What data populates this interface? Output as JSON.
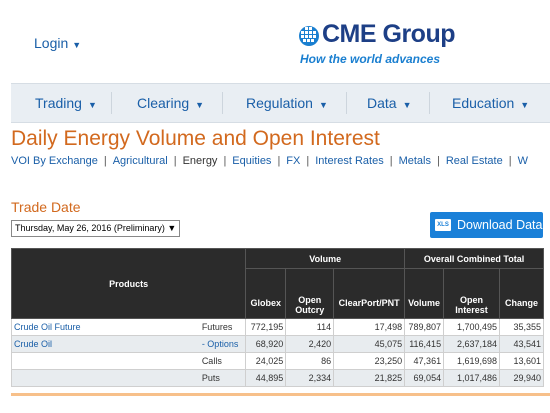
{
  "header": {
    "login_label": "Login",
    "brand_name": "CME Group",
    "tagline": "How the world advances"
  },
  "nav": {
    "items": [
      {
        "label": "Trading"
      },
      {
        "label": "Clearing"
      },
      {
        "label": "Regulation"
      },
      {
        "label": "Data"
      },
      {
        "label": "Education"
      }
    ]
  },
  "page": {
    "title": "Daily Energy Volume and Open Interest",
    "sublinks": [
      "VOI By Exchange",
      "Agricultural",
      "Energy",
      "Equities",
      "FX",
      "Interest Rates",
      "Metals",
      "Real Estate",
      "W"
    ],
    "current_sublink": "Energy",
    "trade_date_label": "Trade Date",
    "trade_date_value": "Thursday, May 26, 2016 (Preliminary)",
    "download_label": "Download Data",
    "download_icon_text": "XLS"
  },
  "table": {
    "products_header": "Products",
    "volume_header": "Volume",
    "oi_header": "Overall Combined Total",
    "columns": [
      "Globex",
      "Open Outcry",
      "ClearPort/PNT",
      "Volume",
      "Open Interest",
      "Change"
    ],
    "rows": [
      {
        "product": "Crude Oil Future",
        "type": "Futures",
        "globex": "772,195",
        "outcry": "114",
        "clearport": "17,498",
        "volume": "789,807",
        "oi": "1,700,495",
        "change": "35,355"
      },
      {
        "product": "Crude Oil",
        "type": "- Options",
        "globex": "68,920",
        "outcry": "2,420",
        "clearport": "45,075",
        "volume": "116,415",
        "oi": "2,637,184",
        "change": "43,541"
      },
      {
        "product": "",
        "type": "Calls",
        "globex": "24,025",
        "outcry": "86",
        "clearport": "23,250",
        "volume": "47,361",
        "oi": "1,619,698",
        "change": "13,601"
      },
      {
        "product": "",
        "type": "Puts",
        "globex": "44,895",
        "outcry": "2,334",
        "clearport": "21,825",
        "volume": "69,054",
        "oi": "1,017,486",
        "change": "29,940"
      }
    ]
  },
  "colors": {
    "accent_orange": "#d2691e",
    "link_blue": "#1a5fa8",
    "brand_navy": "#1d3f86",
    "button_blue": "#1a80d8"
  }
}
